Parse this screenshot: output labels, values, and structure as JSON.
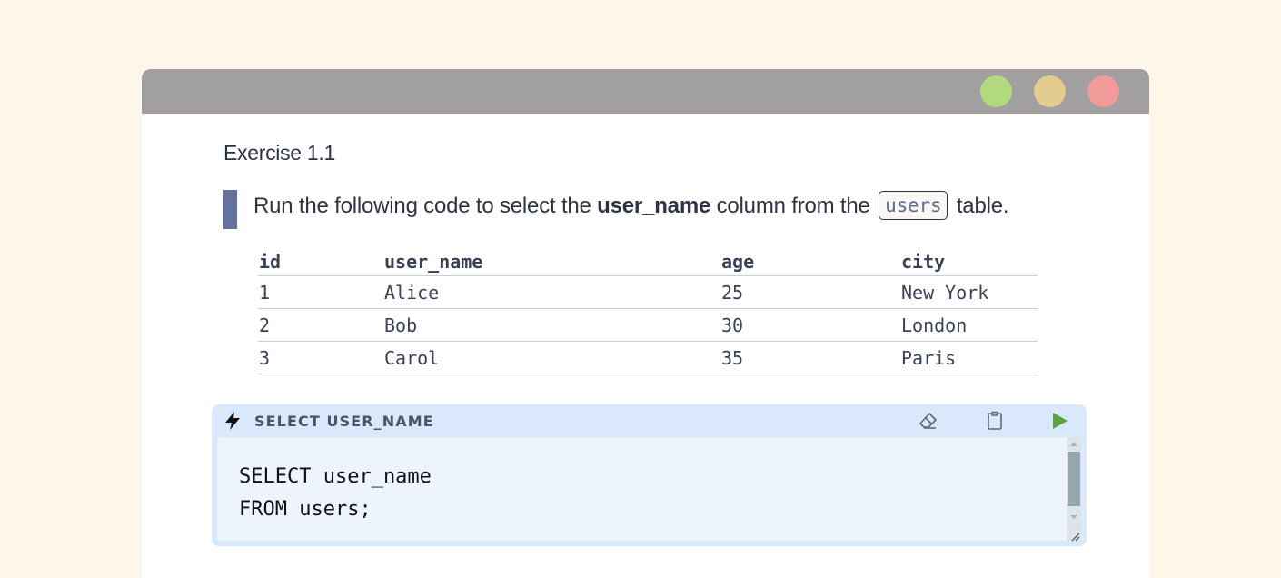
{
  "window": {
    "controls": [
      {
        "name": "maximize",
        "color": "#b3d97f"
      },
      {
        "name": "minimize",
        "color": "#e4cc8f"
      },
      {
        "name": "close",
        "color": "#f19a9a"
      }
    ]
  },
  "exercise": {
    "title": "Exercise 1.1",
    "instruction": {
      "prefix": "Run the following code to select the ",
      "bold": "user_name",
      "middle": " column from the ",
      "code": "users",
      "suffix": " table."
    }
  },
  "table": {
    "columns": [
      "id",
      "user_name",
      "age",
      "city"
    ],
    "rows": [
      [
        "1",
        "Alice",
        "25",
        "New York"
      ],
      [
        "2",
        "Bob",
        "30",
        "London"
      ],
      [
        "3",
        "Carol",
        "35",
        "Paris"
      ]
    ]
  },
  "editor": {
    "title": "SELECT USER_NAME",
    "icons": {
      "header": "bolt-icon",
      "clear": "eraser-icon",
      "copy": "clipboard-icon",
      "run": "play-icon"
    },
    "code_lines": [
      "SELECT user_name",
      "FROM users;"
    ],
    "run_color": "#5aa342"
  }
}
